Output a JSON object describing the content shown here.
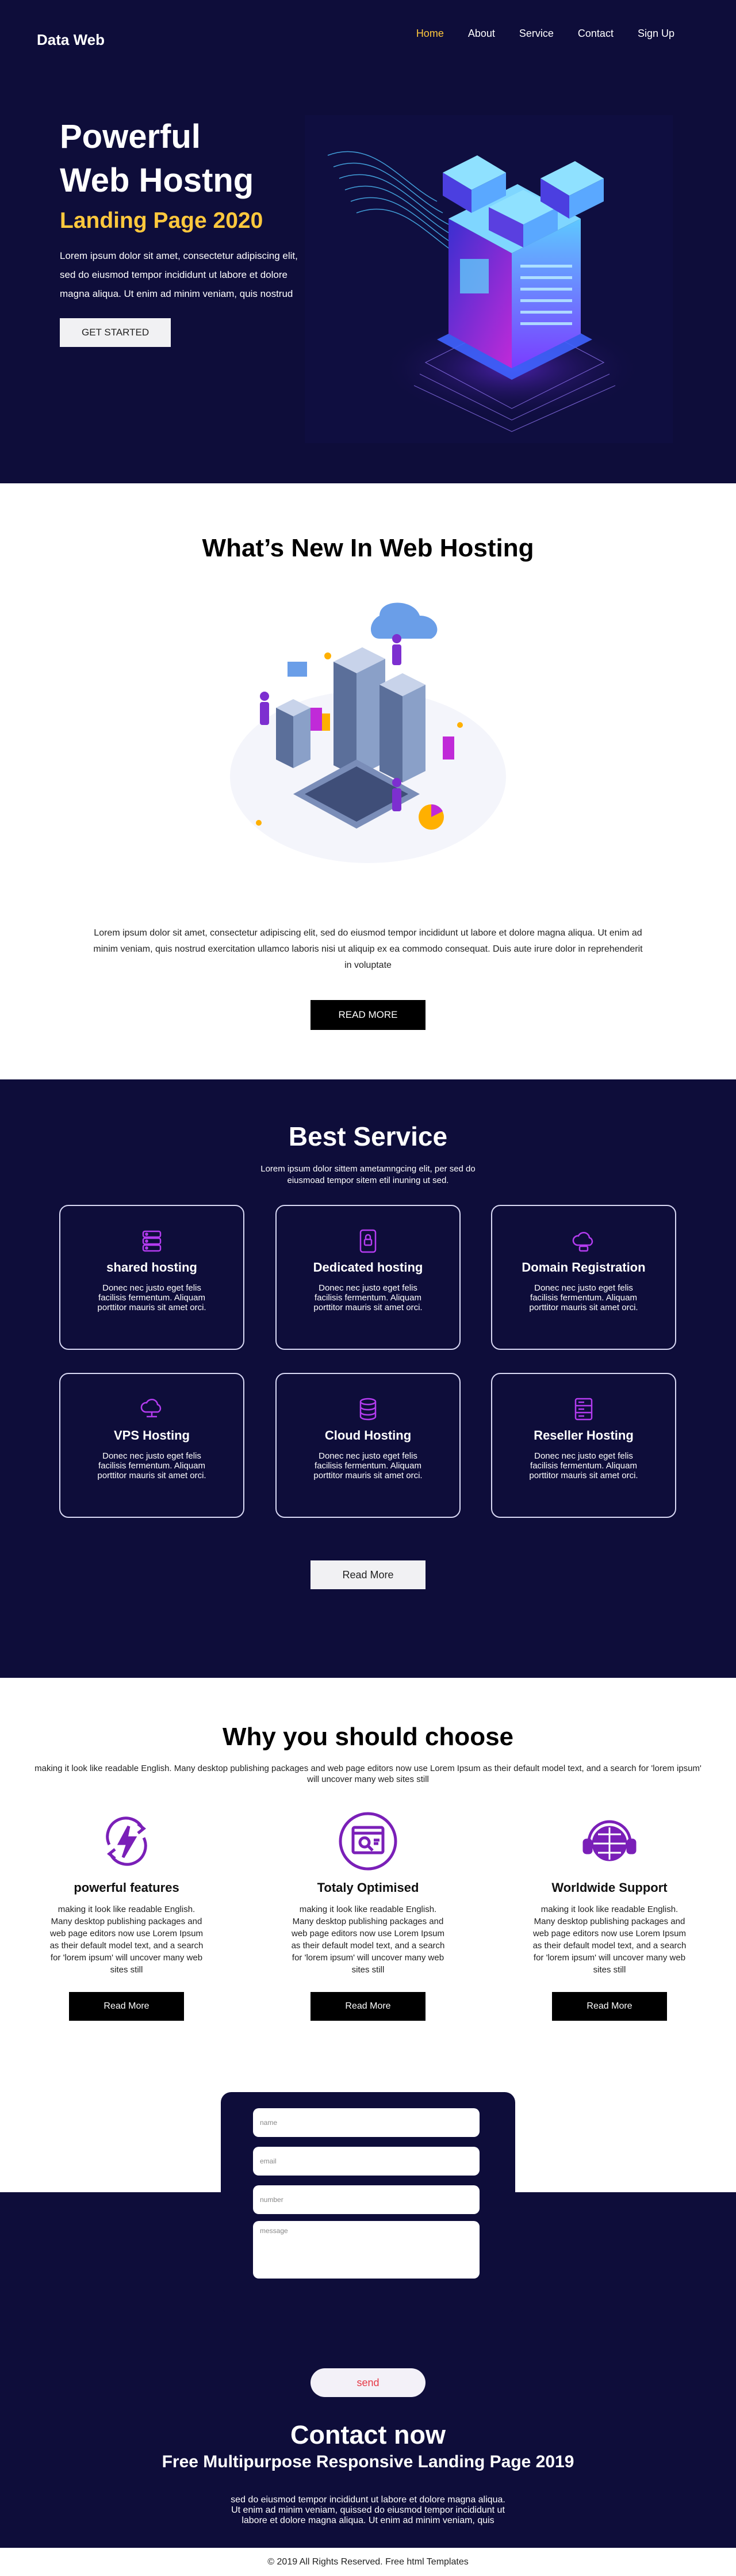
{
  "header": {
    "brand": "Data Web",
    "nav": [
      "Home",
      "About",
      "Service",
      "Contact",
      "Sign Up"
    ]
  },
  "hero": {
    "title_line1": "Powerful",
    "title_line2": "Web Hostng",
    "subtitle": "Landing Page 2020",
    "text": "Lorem ipsum dolor sit amet, consectetur adipiscing elit, sed do eiusmod tempor incididunt ut labore et dolore magna aliqua. Ut enim ad minim veniam, quis nostrud",
    "button": "GET STARTED"
  },
  "whats_new": {
    "title": "What’s New In Web Hosting",
    "text": "Lorem ipsum dolor sit amet, consectetur adipiscing elit, sed do eiusmod tempor incididunt ut labore et dolore magna aliqua. Ut enim ad minim veniam, quis nostrud exercitation ullamco laboris nisi ut aliquip ex ea commodo consequat. Duis aute irure dolor in reprehenderit in voluptate",
    "button": "READ MORE"
  },
  "services": {
    "title": "Best Service",
    "subtitle": "Lorem ipsum dolor sittem ametamngcing elit, per sed do eiusmoad tempor sitem etil inuning ut sed.",
    "items": [
      {
        "title": "shared hosting",
        "desc": "Donec nec justo eget felis facilisis fermentum. Aliquam porttitor mauris sit amet orci.",
        "icon": "server-stack-icon"
      },
      {
        "title": "Dedicated hosting",
        "desc": "Donec nec justo eget felis facilisis fermentum. Aliquam porttitor mauris sit amet orci.",
        "icon": "server-lock-icon"
      },
      {
        "title": "Domain Registration",
        "desc": "Donec nec justo eget felis facilisis fermentum. Aliquam porttitor mauris sit amet orci.",
        "icon": "domain-cloud-icon"
      },
      {
        "title": "VPS Hosting",
        "desc": "Donec nec justo eget felis facilisis fermentum. Aliquam porttitor mauris sit amet orci.",
        "icon": "cloud-network-icon"
      },
      {
        "title": "Cloud Hosting",
        "desc": "Donec nec justo eget felis facilisis fermentum. Aliquam porttitor mauris sit amet orci.",
        "icon": "database-icon"
      },
      {
        "title": "Reseller Hosting",
        "desc": "Donec nec justo eget felis facilisis fermentum. Aliquam porttitor mauris sit amet orci.",
        "icon": "server-rack-icon"
      }
    ],
    "button": "Read More"
  },
  "why": {
    "title": "Why you should choose",
    "subtitle": "making it look like readable English. Many desktop publishing packages and web page editors now use Lorem Ipsum as their default model text, and a search for 'lorem ipsum' will uncover many web sites still",
    "items": [
      {
        "title": "powerful features",
        "desc": "making it look like readable English. Many desktop publishing packages and web page editors now use Lorem Ipsum as their default model text, and a search for 'lorem ipsum' will uncover many web sites still",
        "button": "Read More",
        "icon": "lightning-cycle-icon"
      },
      {
        "title": "Totaly Optimised",
        "desc": "making it look like readable English. Many desktop publishing packages and web page editors now use Lorem Ipsum as their default model text, and a search for 'lorem ipsum' will uncover many web sites still",
        "button": "Read More",
        "icon": "browser-search-icon"
      },
      {
        "title": "Worldwide Support",
        "desc": "making it look like readable English. Many desktop publishing packages and web page editors now use Lorem Ipsum as their default model text, and a search for 'lorem ipsum' will uncover many web sites still",
        "button": "Read More",
        "icon": "globe-headset-icon"
      }
    ]
  },
  "contact": {
    "placeholders": {
      "name": "name",
      "email": "email",
      "number": "number",
      "message": "message"
    },
    "send": "send",
    "title": "Contact now",
    "subtitle": "Free Multipurpose Responsive Landing Page 2019",
    "text": "sed do eiusmod tempor incididunt ut labore et dolore magna aliqua. Ut enim ad minim veniam, quissed do eiusmod tempor incididunt ut labore et dolore magna aliqua. Ut enim ad minim veniam, quis"
  },
  "footer": {
    "text": "© 2019 All Rights Reserved. Free html Templates"
  },
  "colors": {
    "navy": "#0e0d3a",
    "accent_yellow": "#ffc83d",
    "icon_purple": "#8a2be2",
    "send_red": "#e63946"
  }
}
